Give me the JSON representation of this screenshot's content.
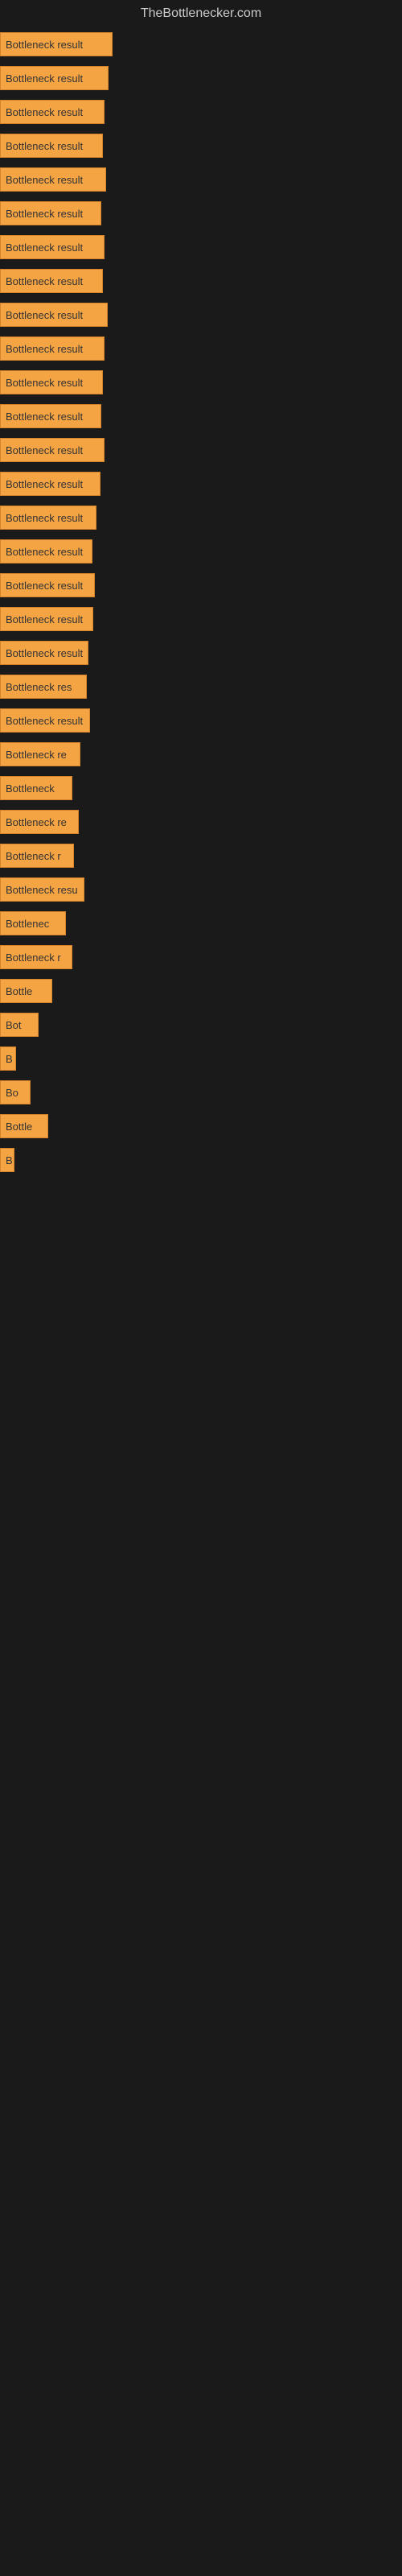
{
  "header": {
    "title": "TheBottlenecker.com"
  },
  "bars": [
    {
      "label": "Bottleneck result",
      "width": 140
    },
    {
      "label": "Bottleneck result",
      "width": 135
    },
    {
      "label": "Bottleneck result",
      "width": 130
    },
    {
      "label": "Bottleneck result",
      "width": 128
    },
    {
      "label": "Bottleneck result",
      "width": 132
    },
    {
      "label": "Bottleneck result",
      "width": 126
    },
    {
      "label": "Bottleneck result",
      "width": 130
    },
    {
      "label": "Bottleneck result",
      "width": 128
    },
    {
      "label": "Bottleneck result",
      "width": 134
    },
    {
      "label": "Bottleneck result",
      "width": 130
    },
    {
      "label": "Bottleneck result",
      "width": 128
    },
    {
      "label": "Bottleneck result",
      "width": 126
    },
    {
      "label": "Bottleneck result",
      "width": 130
    },
    {
      "label": "Bottleneck result",
      "width": 125
    },
    {
      "label": "Bottleneck result",
      "width": 120
    },
    {
      "label": "Bottleneck result",
      "width": 115
    },
    {
      "label": "Bottleneck result",
      "width": 118
    },
    {
      "label": "Bottleneck result",
      "width": 116
    },
    {
      "label": "Bottleneck result",
      "width": 110
    },
    {
      "label": "Bottleneck res",
      "width": 108
    },
    {
      "label": "Bottleneck result",
      "width": 112
    },
    {
      "label": "Bottleneck re",
      "width": 100
    },
    {
      "label": "Bottleneck",
      "width": 90
    },
    {
      "label": "Bottleneck re",
      "width": 98
    },
    {
      "label": "Bottleneck r",
      "width": 92
    },
    {
      "label": "Bottleneck resu",
      "width": 105
    },
    {
      "label": "Bottlenec",
      "width": 82
    },
    {
      "label": "Bottleneck r",
      "width": 90
    },
    {
      "label": "Bottle",
      "width": 65
    },
    {
      "label": "Bot",
      "width": 48
    },
    {
      "label": "B",
      "width": 20
    },
    {
      "label": "Bo",
      "width": 38
    },
    {
      "label": "Bottle",
      "width": 60
    },
    {
      "label": "B",
      "width": 18
    },
    {
      "label": "",
      "width": 0
    },
    {
      "label": "",
      "width": 0
    },
    {
      "label": "",
      "width": 0
    },
    {
      "label": "",
      "width": 0
    },
    {
      "label": "",
      "width": 0
    },
    {
      "label": "",
      "width": 0
    },
    {
      "label": "",
      "width": 0
    },
    {
      "label": "",
      "width": 0
    }
  ]
}
